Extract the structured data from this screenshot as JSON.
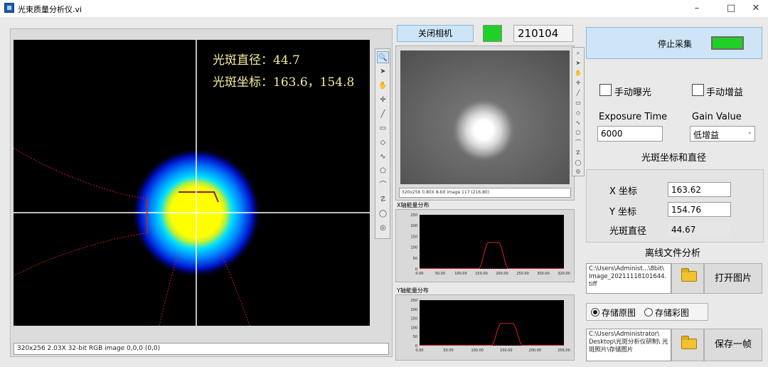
{
  "window": {
    "title": "光束质量分析仪.vi"
  },
  "left_display": {
    "diameter_label": "光斑直径：",
    "diameter_value": "44.7",
    "coord_label": "光斑坐标：",
    "coord_value": "163.6，154.8",
    "status": "320x256 2.03X 32-bit RGB image 0,0,0     (0,0)"
  },
  "camera": {
    "button_label": "关闭相机",
    "led_color": "#1fd126",
    "counter": "210104",
    "status": "320x256 0.80X 8-bit image 117     (216,80)"
  },
  "x_plot": {
    "title": "X轴能量分布",
    "y_ticks": [
      "250",
      "200",
      "150",
      "100",
      "50",
      "0"
    ],
    "x_ticks": [
      "0.00",
      "50.00",
      "100.00",
      "150.00",
      "200.00",
      "250.00",
      "300.00",
      "320.00"
    ],
    "ylim": [
      0,
      250
    ],
    "xlim": [
      0,
      320
    ]
  },
  "y_plot": {
    "title": "Y轴能量分布",
    "y_ticks": [
      "250",
      "200",
      "150",
      "100",
      "50",
      "0"
    ],
    "x_ticks": [
      "0.00",
      "50.00",
      "100.00",
      "150.00",
      "200.00",
      "256.00"
    ],
    "ylim": [
      0,
      250
    ],
    "xlim": [
      0,
      256
    ]
  },
  "controls": {
    "stop_label": "停止采集",
    "stop_led_color": "#1fd126",
    "manual_exposure": "手动曝光",
    "manual_gain": "手动增益",
    "exposure_label": "Exposure Time",
    "exposure_value": "6000",
    "gain_label": "Gain Value",
    "gain_value": "低增益",
    "section_title": "光斑坐标和直径",
    "x_label": "X 坐标",
    "x_value": "163.62",
    "y_label": "Y 坐标",
    "y_value": "154.76",
    "d_label": "光斑直径",
    "d_value": "44.67",
    "offline_title": "离线文件分析",
    "open_path": "C:\\Users\\Administ...\\8bit\\ Image_20211118101644. tiff",
    "open_button": "打开图片",
    "radio_raw": "存储原图",
    "radio_color": "存储彩图",
    "save_path": "C:\\Users\\Administrator\\ Desktop\\光斑分析仪研制\\ 光斑照片\\存储图片",
    "save_button": "保存一帧"
  }
}
